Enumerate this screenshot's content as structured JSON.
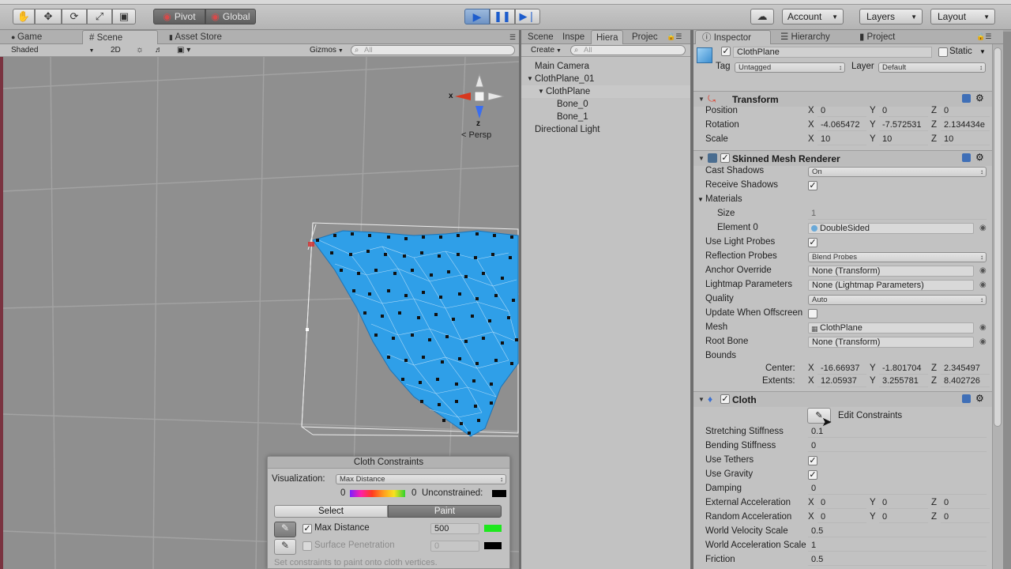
{
  "toolbar": {
    "pivot": "Pivot",
    "global": "Global",
    "account": "Account",
    "layers": "Layers",
    "layout": "Layout"
  },
  "scene_panel": {
    "tabs": [
      "Game",
      "Scene",
      "Asset Store"
    ],
    "shading": "Shaded",
    "mode_2d": "2D",
    "gizmos": "Gizmos",
    "search_placeholder": "All",
    "gizmo": {
      "x": "x",
      "z": "z",
      "persp": "Persp"
    }
  },
  "hierarchy_panel": {
    "tabs": [
      "Scene",
      "Inspe",
      "Hiera",
      "Projec"
    ],
    "create": "Create",
    "search_placeholder": "All",
    "items": [
      {
        "label": "Main Camera",
        "depth": 0,
        "arrow": ""
      },
      {
        "label": "ClothPlane_01",
        "depth": 0,
        "arrow": "▼"
      },
      {
        "label": "ClothPlane",
        "depth": 1,
        "arrow": "▼"
      },
      {
        "label": "Bone_0",
        "depth": 2,
        "arrow": ""
      },
      {
        "label": "Bone_1",
        "depth": 2,
        "arrow": ""
      },
      {
        "label": "Directional Light",
        "depth": 0,
        "arrow": ""
      }
    ]
  },
  "inspector_tabs": [
    "Inspector",
    "Hierarchy",
    "Project"
  ],
  "inspector": {
    "object_name": "ClothPlane",
    "static": "Static",
    "tag_label": "Tag",
    "tag_value": "Untagged",
    "layer_label": "Layer",
    "layer_value": "Default",
    "transform": {
      "title": "Transform",
      "rows": [
        {
          "label": "Position",
          "x": "0",
          "y": "0",
          "z": "0"
        },
        {
          "label": "Rotation",
          "x": "-4.065472",
          "y": "-7.572531",
          "z": "2.134434e"
        },
        {
          "label": "Scale",
          "x": "10",
          "y": "10",
          "z": "10"
        }
      ]
    },
    "skinned": {
      "title": "Skinned Mesh Renderer",
      "cast_shadows_label": "Cast Shadows",
      "cast_shadows": "On",
      "receive_shadows_label": "Receive Shadows",
      "materials_label": "Materials",
      "size_label": "Size",
      "size": "1",
      "element0_label": "Element 0",
      "element0": "DoubleSided",
      "light_probes_label": "Use Light Probes",
      "reflection_label": "Reflection Probes",
      "reflection": "Blend Probes",
      "anchor_label": "Anchor Override",
      "anchor": "None (Transform)",
      "lightmap_label": "Lightmap Parameters",
      "lightmap": "None (Lightmap Parameters)",
      "quality_label": "Quality",
      "quality": "Auto",
      "offscreen_label": "Update When Offscreen",
      "mesh_label": "Mesh",
      "mesh": "ClothPlane",
      "rootbone_label": "Root Bone",
      "rootbone": "None (Transform)",
      "bounds_label": "Bounds",
      "center_label": "Center:",
      "center": {
        "x": "-16.66937",
        "y": "-1.801704",
        "z": "2.345497"
      },
      "extents_label": "Extents:",
      "extents": {
        "x": "12.05937",
        "y": "3.255781",
        "z": "8.402726"
      }
    },
    "cloth": {
      "title": "Cloth",
      "edit_constraints": "Edit Constraints",
      "stretching_label": "Stretching Stiffness",
      "stretching": "0.1",
      "bending_label": "Bending Stiffness",
      "bending": "0",
      "tethers_label": "Use Tethers",
      "gravity_label": "Use Gravity",
      "damping_label": "Damping",
      "damping": "0",
      "ext_accel_label": "External Acceleration",
      "ext_accel": {
        "x": "0",
        "y": "0",
        "z": "0"
      },
      "rand_accel_label": "Random Acceleration",
      "rand_accel": {
        "x": "0",
        "y": "0",
        "z": "0"
      },
      "world_vel_label": "World Velocity Scale",
      "world_vel": "0.5",
      "world_acc_label": "World Acceleration Scale",
      "world_acc": "1",
      "friction_label": "Friction",
      "friction": "0.5"
    }
  },
  "cloth_constraints": {
    "title": "Cloth Constraints",
    "visualization_label": "Visualization:",
    "visualization": "Max Distance",
    "range_min": "0",
    "range_max": "0",
    "unconstrained": "Unconstrained:",
    "select": "Select",
    "paint": "Paint",
    "max_distance_label": "Max Distance",
    "max_distance": "500",
    "surface_label": "Surface Penetration",
    "surface": "0",
    "hint": "Set constraints to paint onto cloth vertices."
  },
  "colors": {
    "accent": "#2f9fe8",
    "play_blue": "#2a66c4",
    "selection": "#3e7ce0"
  }
}
